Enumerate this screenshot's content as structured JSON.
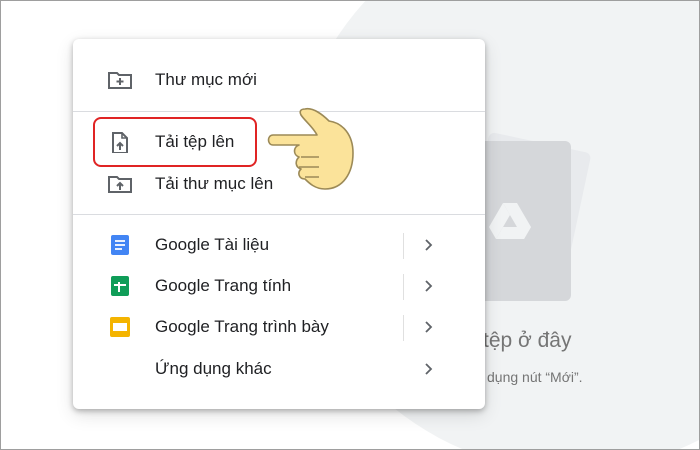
{
  "menu": {
    "items": [
      {
        "label": "Thư mục mới",
        "icon": "new-folder-icon"
      },
      {
        "label": "Tải tệp lên",
        "icon": "file-upload-icon"
      },
      {
        "label": "Tải thư mục lên",
        "icon": "folder-upload-icon"
      },
      {
        "label": "Google Tài liệu",
        "icon": "google-docs-icon"
      },
      {
        "label": "Google Trang tính",
        "icon": "google-sheets-icon"
      },
      {
        "label": "Google Trang trình bày",
        "icon": "google-slides-icon"
      },
      {
        "label": "Ứng dụng khác",
        "icon": ""
      }
    ]
  },
  "empty_state": {
    "title": "tệp ở đây",
    "subtitle": "dụng nút “Mới”."
  },
  "colors": {
    "docs_blue": "#4285f4",
    "sheets_green": "#0f9d58",
    "slides_yellow": "#f4b400",
    "highlight_red": "#e02424",
    "hand_fill": "#fbe39a"
  }
}
